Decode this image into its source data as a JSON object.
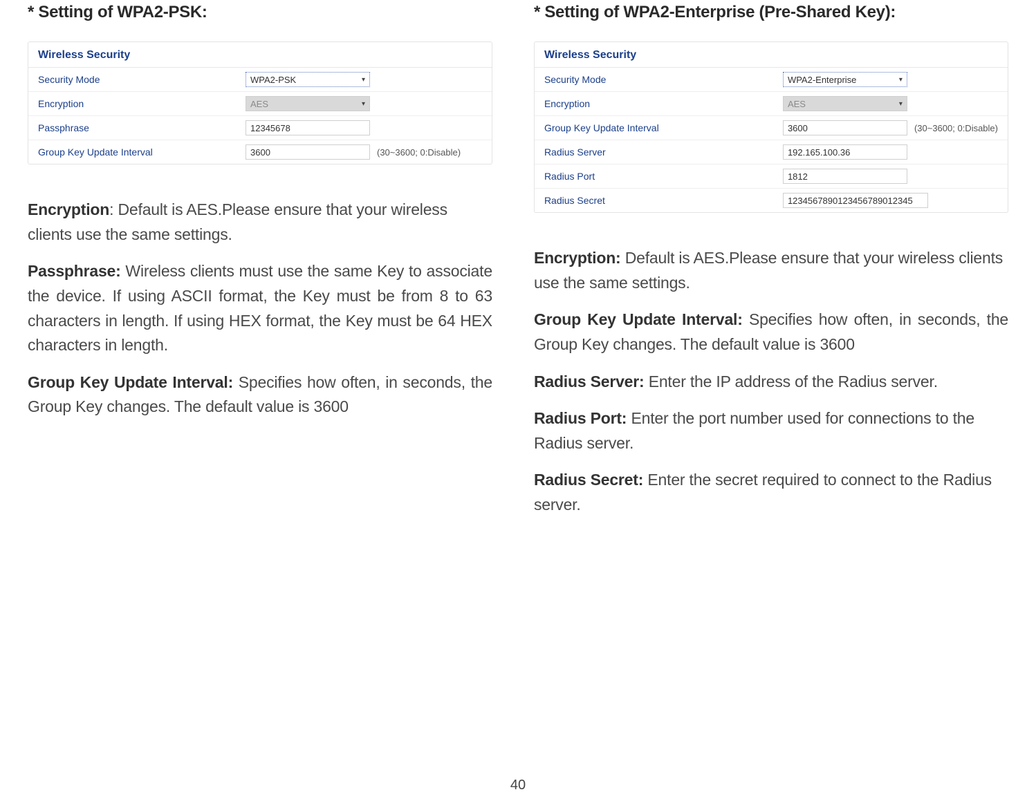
{
  "page_number": "40",
  "left": {
    "heading": "* Setting of WPA2-PSK:",
    "panel_title": "Wireless Security",
    "rows": {
      "security_mode": {
        "label": "Security Mode",
        "value": "WPA2-PSK"
      },
      "encryption": {
        "label": "Encryption",
        "value": "AES"
      },
      "passphrase": {
        "label": "Passphrase",
        "value": "12345678"
      },
      "group_key": {
        "label": "Group Key Update Interval",
        "value": "3600",
        "suffix": "(30~3600; 0:Disable)"
      }
    },
    "paragraphs": {
      "encryption": {
        "lead": "Encryption",
        "body": ": Default is AES.Please ensure that your wireless clients use the same settings."
      },
      "passphrase": {
        "lead": "Passphrase:",
        "body": " Wireless clients must use the same Key to associate the device. If using ASCII format, the Key must be from 8 to 63 characters in length. If using HEX format, the Key must be 64 HEX characters in length."
      },
      "group_key": {
        "lead": "Group Key Update Interval:",
        "body": " Specifies how often, in seconds, the Group Key changes. The default value is 3600"
      }
    }
  },
  "right": {
    "heading": "* Setting of WPA2-Enterprise (Pre-Shared Key):",
    "panel_title": "Wireless Security",
    "rows": {
      "security_mode": {
        "label": "Security Mode",
        "value": "WPA2-Enterprise"
      },
      "encryption": {
        "label": "Encryption",
        "value": "AES"
      },
      "group_key": {
        "label": "Group Key Update Interval",
        "value": "3600",
        "suffix": "(30~3600; 0:Disable)"
      },
      "radius_server": {
        "label": "Radius Server",
        "value": "192.165.100.36"
      },
      "radius_port": {
        "label": "Radius Port",
        "value": "1812"
      },
      "radius_secret": {
        "label": "Radius Secret",
        "value": "1234567890123456789012345"
      }
    },
    "paragraphs": {
      "encryption": {
        "lead": "Encryption:",
        "body": " Default is AES.Please ensure that your wireless clients use the same settings."
      },
      "group_key": {
        "lead": "Group Key Update Interval:",
        "body": " Specifies how often, in seconds, the Group Key changes. The default value is 3600"
      },
      "radius_server": {
        "lead": "Radius Server:",
        "body": " Enter the IP address of the Radius server."
      },
      "radius_port": {
        "lead": "Radius Port:",
        "body": " Enter the port number used for connections to the Radius server."
      },
      "radius_secret": {
        "lead": "Radius Secret:",
        "body": " Enter the secret required to connect to the Radius server."
      }
    }
  },
  "icons": {
    "caret": "▾"
  }
}
